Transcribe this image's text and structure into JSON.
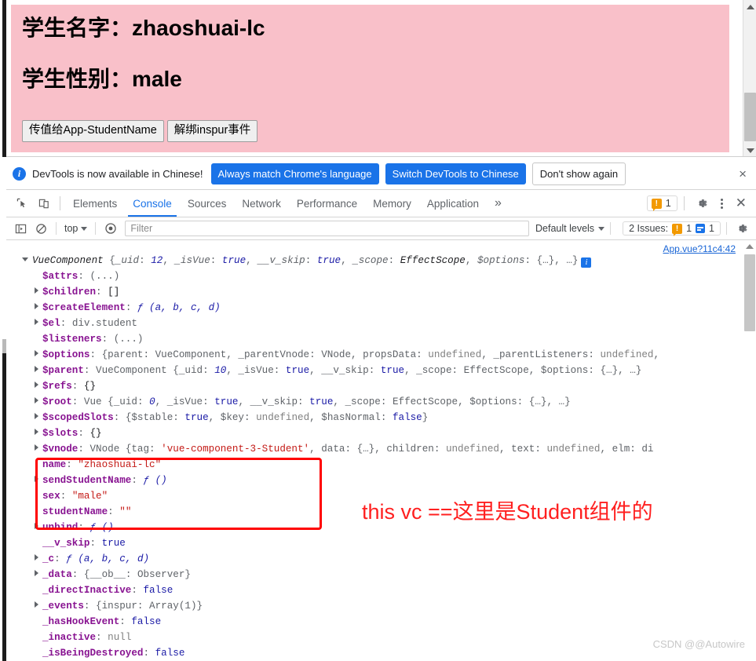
{
  "app_page": {
    "name_label": "学生名字：",
    "name_value": "zhaoshuai-lc",
    "sex_label": "学生性别：",
    "sex_value": "male",
    "buttons": [
      {
        "label": "传值给App-StudentName"
      },
      {
        "label": "解绑inspur事件"
      }
    ],
    "background_color": "#f9c0c9"
  },
  "devtools_banner": {
    "message": "DevTools is now available in Chinese!",
    "primary_button": "Always match Chrome's language",
    "secondary_button": "Switch DevTools to Chinese",
    "dismiss_button": "Don't show again",
    "close_label": "×",
    "accent_color": "#1a73e8"
  },
  "devtools_tabs": {
    "items": [
      {
        "label": "Elements",
        "active": false
      },
      {
        "label": "Console",
        "active": true
      },
      {
        "label": "Sources",
        "active": false
      },
      {
        "label": "Network",
        "active": false
      },
      {
        "label": "Performance",
        "active": false
      },
      {
        "label": "Memory",
        "active": false
      },
      {
        "label": "Application",
        "active": false
      }
    ],
    "overflow_label": "»",
    "warning_count": "1",
    "close_label": "✕"
  },
  "console_toolbar": {
    "context": "top",
    "filter_placeholder": "Filter",
    "filter_value": "",
    "levels": "Default levels",
    "issues_label": "2 Issues:",
    "issues_warning_count": "1",
    "issues_info_count": "1"
  },
  "console": {
    "source_link": "App.vue?11c4:42",
    "lines": [
      {
        "indent": 0,
        "tri": "open",
        "html": "<span class=\"cls\">VueComponent</span> <span class=\"v-gray\">{</span><span class=\"v-gray v-italic\">_uid</span><span class=\"v-gray\">: </span><span class=\"v-num\">12</span><span class=\"v-gray\">, </span><span class=\"v-gray v-italic\">_isVue</span><span class=\"v-gray\">: </span><span class=\"v-bool v-italic\">true</span><span class=\"v-gray\">, </span><span class=\"v-gray v-italic\">__v_skip</span><span class=\"v-gray\">: </span><span class=\"v-bool v-italic\">true</span><span class=\"v-gray\">, </span><span class=\"v-gray v-italic\">_scope</span><span class=\"v-gray\">: </span><span class=\"cls\">EffectScope</span><span class=\"v-gray\">, </span><span class=\"v-gray v-italic\">$options</span><span class=\"v-gray\">: {…}, …}</span><span class=\"info-badge-sm\">i</span>"
      },
      {
        "indent": 1,
        "tri": "blank",
        "html": "<span class=\"k-prop\">$attrs</span><span class=\"v-gray\">: (...)</span>"
      },
      {
        "indent": 1,
        "tri": "closed",
        "html": "<span class=\"k-prop\">$children</span><span class=\"v-gray\">: </span><span class=\"v-obj\">[]</span>"
      },
      {
        "indent": 1,
        "tri": "closed",
        "html": "<span class=\"k-prop\">$createElement</span><span class=\"v-gray\">: </span><span class=\"v-fn\">ƒ (a, b, c, d)</span>"
      },
      {
        "indent": 1,
        "tri": "closed",
        "html": "<span class=\"k-prop\">$el</span><span class=\"v-gray\">: </span><span class=\"v-gray\">div.student</span>"
      },
      {
        "indent": 1,
        "tri": "blank",
        "html": "<span class=\"k-prop\">$listeners</span><span class=\"v-gray\">: (...)</span>"
      },
      {
        "indent": 1,
        "tri": "closed",
        "html": "<span class=\"k-prop\">$options</span><span class=\"v-gray\">: {parent: </span><span class=\"v-gray\">VueComponent</span><span class=\"v-gray\">, _parentVnode: </span><span class=\"v-gray\">VNode</span><span class=\"v-gray\">, propsData: </span><span class=\"v-undef\">undefined</span><span class=\"v-gray\">, _parentListeners: </span><span class=\"v-undef\">undefined</span><span class=\"v-gray\">,</span>"
      },
      {
        "indent": 1,
        "tri": "closed",
        "html": "<span class=\"k-prop\">$parent</span><span class=\"v-gray\">: </span><span class=\"v-gray\">VueComponent {_uid: </span><span class=\"v-num\">10</span><span class=\"v-gray\">, _isVue: </span><span class=\"v-bool\">true</span><span class=\"v-gray\">, __v_skip: </span><span class=\"v-bool\">true</span><span class=\"v-gray\">, _scope: EffectScope, $options: {…}, …}</span>"
      },
      {
        "indent": 1,
        "tri": "closed",
        "html": "<span class=\"k-prop\">$refs</span><span class=\"v-gray\">: </span><span class=\"v-obj\">{}</span>"
      },
      {
        "indent": 1,
        "tri": "closed",
        "html": "<span class=\"k-prop\">$root</span><span class=\"v-gray\">: </span><span class=\"v-gray\">Vue {_uid: </span><span class=\"v-num\">0</span><span class=\"v-gray\">, _isVue: </span><span class=\"v-bool\">true</span><span class=\"v-gray\">, __v_skip: </span><span class=\"v-bool\">true</span><span class=\"v-gray\">, _scope: EffectScope, $options: {…}, …}</span>"
      },
      {
        "indent": 1,
        "tri": "closed",
        "html": "<span class=\"k-prop\">$scopedSlots</span><span class=\"v-gray\">: {$stable: </span><span class=\"v-bool\">true</span><span class=\"v-gray\">, $key: </span><span class=\"v-undef\">undefined</span><span class=\"v-gray\">, $hasNormal: </span><span class=\"v-bool\">false</span><span class=\"v-gray\">}</span>"
      },
      {
        "indent": 1,
        "tri": "closed",
        "html": "<span class=\"k-prop\">$slots</span><span class=\"v-gray\">: </span><span class=\"v-obj\">{}</span>"
      },
      {
        "indent": 1,
        "tri": "closed",
        "html": "<span class=\"k-prop\">$vnode</span><span class=\"v-gray\">: VNode {tag: </span><span class=\"v-str\">'vue-component-3-Student'</span><span class=\"v-gray\">, data: {…}, children: </span><span class=\"v-undef\">undefined</span><span class=\"v-gray\">, text: </span><span class=\"v-undef\">undefined</span><span class=\"v-gray\">, elm: di</span>"
      },
      {
        "indent": 1,
        "tri": "blank",
        "html": "<span class=\"k-prop\">name</span><span class=\"v-gray\">: </span><span class=\"v-str\">\"zhaoshuai-lc\"</span>"
      },
      {
        "indent": 1,
        "tri": "closed",
        "html": "<span class=\"k-prop\">sendStudentName</span><span class=\"v-gray\">: </span><span class=\"v-fn\">ƒ ()</span>"
      },
      {
        "indent": 1,
        "tri": "blank",
        "html": "<span class=\"k-prop\">sex</span><span class=\"v-gray\">: </span><span class=\"v-str\">\"male\"</span>"
      },
      {
        "indent": 1,
        "tri": "blank",
        "html": "<span class=\"k-prop\">studentName</span><span class=\"v-gray\">: </span><span class=\"v-str\">\"\"</span>"
      },
      {
        "indent": 1,
        "tri": "closed",
        "html": "<span class=\"k-prop\">unbind</span><span class=\"v-gray\">: </span><span class=\"v-fn\">ƒ ()</span>"
      },
      {
        "indent": 1,
        "tri": "blank",
        "html": "<span class=\"k-prop\">__v_skip</span><span class=\"v-gray\">: </span><span class=\"v-bool\">true</span>"
      },
      {
        "indent": 1,
        "tri": "closed",
        "html": "<span class=\"k-prop\">_c</span><span class=\"v-gray\">: </span><span class=\"v-fn\">ƒ (a, b, c, d)</span>"
      },
      {
        "indent": 1,
        "tri": "closed",
        "html": "<span class=\"k-prop\">_data</span><span class=\"v-gray\">: {__ob__: </span><span class=\"v-gray\">Observer</span><span class=\"v-gray\">}</span>"
      },
      {
        "indent": 1,
        "tri": "blank",
        "html": "<span class=\"k-prop\">_directInactive</span><span class=\"v-gray\">: </span><span class=\"v-bool\">false</span>"
      },
      {
        "indent": 1,
        "tri": "closed",
        "html": "<span class=\"k-prop\">_events</span><span class=\"v-gray\">: {inspur: </span><span class=\"v-gray\">Array(1)</span><span class=\"v-gray\">}</span>"
      },
      {
        "indent": 1,
        "tri": "blank",
        "html": "<span class=\"k-prop\">_hasHookEvent</span><span class=\"v-gray\">: </span><span class=\"v-bool\">false</span>"
      },
      {
        "indent": 1,
        "tri": "blank",
        "html": "<span class=\"k-prop\">_inactive</span><span class=\"v-gray\">: </span><span class=\"v-null\">null</span>"
      },
      {
        "indent": 1,
        "tri": "blank",
        "html": "<span class=\"k-prop\">_isBeingDestroyed</span><span class=\"v-gray\">: </span><span class=\"v-bool\">false</span>"
      }
    ]
  },
  "annotation": {
    "text": "this vc ==这里是Student组件的",
    "color": "#ff2020",
    "box_color": "#ff0000"
  },
  "watermark": {
    "text": "CSDN @@Autowire"
  }
}
